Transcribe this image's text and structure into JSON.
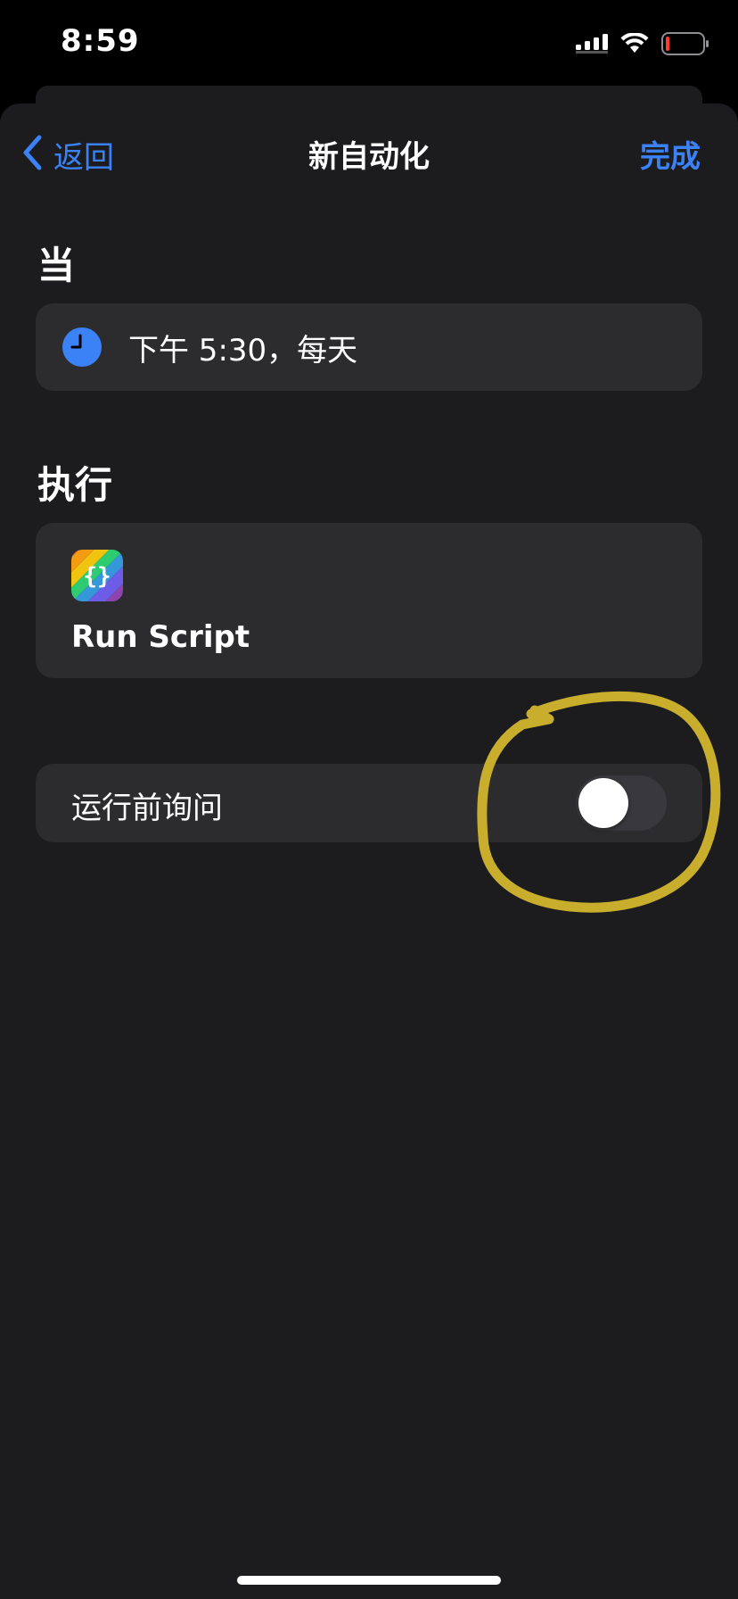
{
  "status_bar": {
    "time": "8:59",
    "icons": [
      "cellular-signal-icon",
      "wifi-icon",
      "battery-low-icon"
    ]
  },
  "nav": {
    "back_label": "返回",
    "title": "新自动化",
    "done_label": "完成"
  },
  "when_section": {
    "header": "当",
    "trigger_text": "下午 5:30，每天",
    "icon": "clock-icon"
  },
  "do_section": {
    "header": "执行",
    "action_label": "Run Script",
    "icon": "scriptable-braces-icon"
  },
  "ask_before_running": {
    "label": "运行前询问",
    "enabled": false
  },
  "colors": {
    "accent": "#3b82f6",
    "sheet_background": "#1c1c1e",
    "card_background": "#2c2c2e",
    "annotation": "#c9ae2e"
  }
}
